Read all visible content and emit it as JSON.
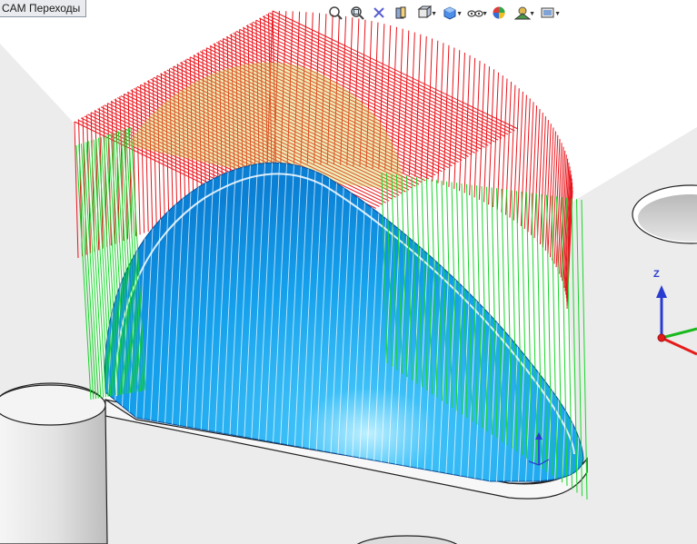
{
  "tab": {
    "label": "CAM Переходы"
  },
  "toolbar": {
    "items": [
      {
        "name": "zoom-to-fit-icon"
      },
      {
        "name": "zoom-area-icon"
      },
      {
        "name": "previous-view-icon"
      },
      {
        "name": "section-view-icon"
      },
      {
        "name": "view-orientation-icon"
      },
      {
        "name": "display-style-icon"
      },
      {
        "name": "hide-show-items-icon"
      },
      {
        "name": "edit-appearance-icon"
      },
      {
        "name": "apply-scene-icon"
      },
      {
        "name": "view-settings-icon"
      }
    ]
  },
  "triad": {
    "z_label": "Z"
  },
  "colors": {
    "background": "#ffffff",
    "stock": "#eeeeee",
    "part_blue": "#1aa3f0",
    "toolpath_red": "#e8141b",
    "toolpath_green": "#18d62a",
    "axis_x": "#e41b1b",
    "axis_y": "#19b81c",
    "axis_z": "#2a3bd0"
  }
}
